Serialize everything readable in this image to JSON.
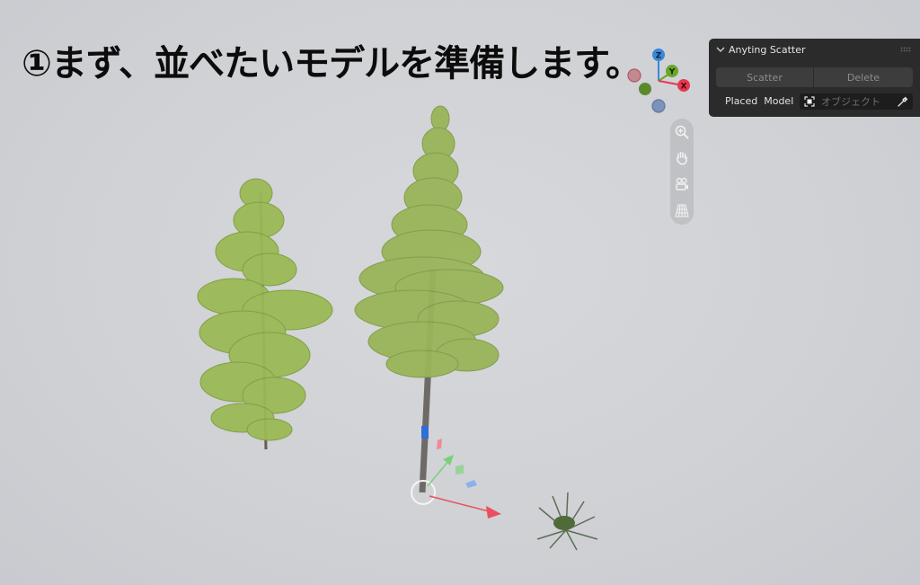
{
  "caption": "①まず、並べたいモデルを準備します。",
  "gizmo": {
    "axes": [
      "Z",
      "Y",
      "X"
    ],
    "colors": {
      "x": "#e8384f",
      "y": "#6aa728",
      "z": "#3a88d8"
    }
  },
  "nav_toolbar": {
    "icons": [
      "zoom-icon",
      "pan-hand-icon",
      "camera-icon",
      "grid-perspective-icon"
    ]
  },
  "panel": {
    "title": "Anyting Scatter",
    "scatter_label": "Scatter",
    "delete_label": "Delete",
    "placed_model_label": "Placed  Model",
    "object_placeholder": "オブジェクト"
  },
  "scene": {
    "objects": [
      "pine-tree-small",
      "pine-tree-tall",
      "fern-plant"
    ],
    "selected": "pine-tree-tall"
  }
}
